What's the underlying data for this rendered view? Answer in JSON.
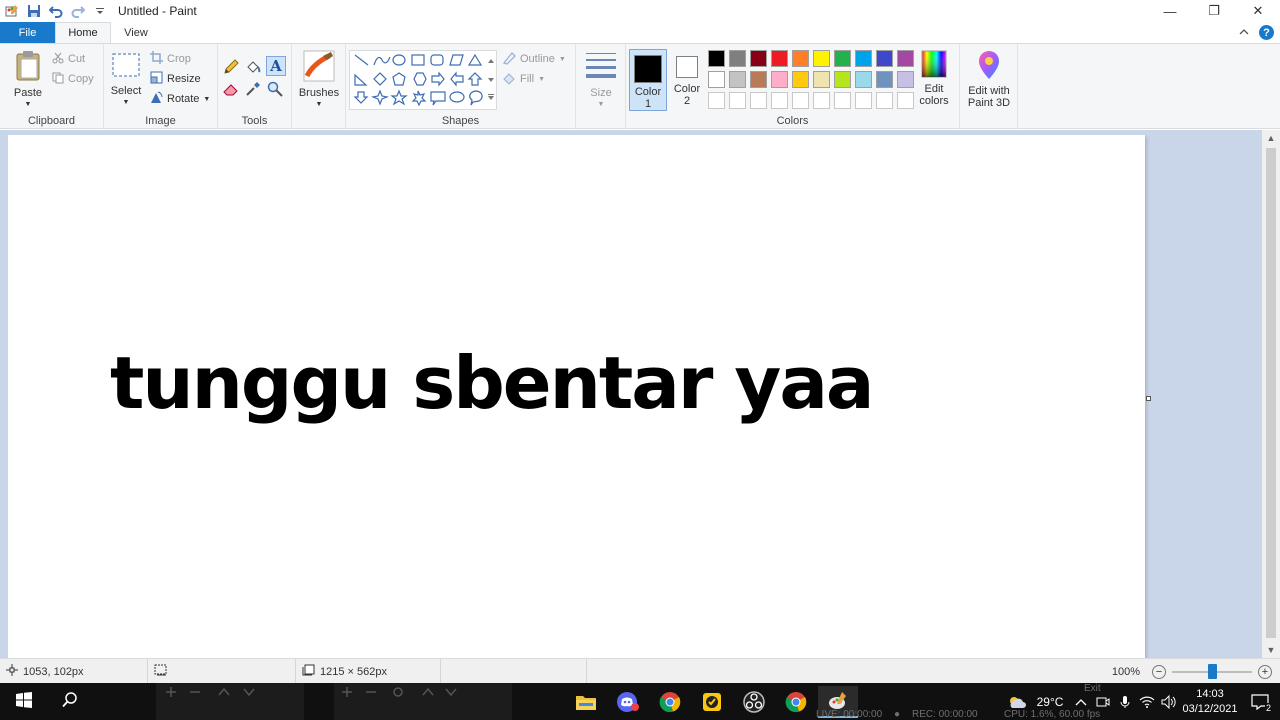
{
  "window": {
    "title": "Untitled - Paint",
    "controls": {
      "minimize": "—",
      "maximize": "❐",
      "close": "✕"
    }
  },
  "tabs": [
    {
      "label": "File"
    },
    {
      "label": "Home"
    },
    {
      "label": "View"
    }
  ],
  "ribbon": {
    "clipboard": {
      "label": "Clipboard",
      "paste": "Paste",
      "cut": "Cut",
      "copy": "Copy"
    },
    "image": {
      "label": "Image",
      "select": "Select",
      "crop": "Crop",
      "resize": "Resize",
      "rotate": "Rotate"
    },
    "tools": {
      "label": "Tools"
    },
    "brushes": {
      "label": "Brushes"
    },
    "shapes": {
      "label": "Shapes",
      "outline": "Outline",
      "fill": "Fill"
    },
    "size": {
      "label": "Size"
    },
    "colors": {
      "label": "Colors",
      "color1": "Color 1",
      "color2": "Color 2",
      "color1_value": "#000000",
      "color2_value": "#ffffff",
      "edit_colors": "Edit colors",
      "palette_row1": [
        "#000000",
        "#7f7f7f",
        "#880015",
        "#ed1c24",
        "#ff7f27",
        "#fff200",
        "#22b14c",
        "#00a2e8",
        "#3f48cc",
        "#a349a4"
      ],
      "palette_row2": [
        "#ffffff",
        "#c3c3c3",
        "#b97a57",
        "#ffaec9",
        "#ffc90e",
        "#efe4b0",
        "#b5e61d",
        "#99d9ea",
        "#7092be",
        "#c8bfe7"
      ],
      "palette_row3": [
        "#ffffff",
        "#ffffff",
        "#ffffff",
        "#ffffff",
        "#ffffff",
        "#ffffff",
        "#ffffff",
        "#ffffff",
        "#ffffff",
        "#ffffff"
      ]
    },
    "paint3d": {
      "label": "Edit with Paint 3D"
    }
  },
  "canvas": {
    "text": "tunggu sbentar yaa"
  },
  "statusbar": {
    "cursor_position": "1053, 102px",
    "canvas_size": "1215 × 562px",
    "zoom": "100%",
    "zoom_level": 0.5
  },
  "taskbar": {
    "weather": "29°C",
    "time": "14:03",
    "date": "03/12/2021",
    "obs_live": "LIVE: 00:00:00",
    "obs_rec": "REC: 00:00:00",
    "obs_cpu": "CPU: 1.6%, 60.00 fps",
    "obs_exit": "Exit",
    "notification_count": "2"
  }
}
